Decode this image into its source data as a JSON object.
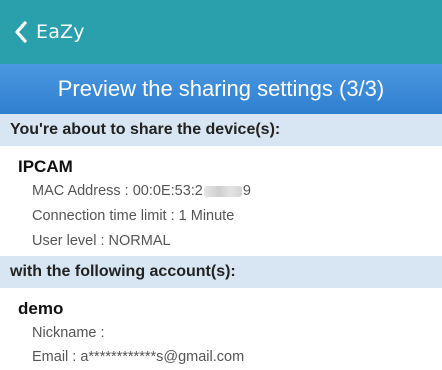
{
  "nav": {
    "back_label": "EaZy"
  },
  "header": {
    "title": "Preview the sharing settings (3/3)"
  },
  "devices_section": {
    "heading": "You're about to share the device(s):",
    "device": {
      "name": "IPCAM",
      "mac_prefix": "MAC Address : 00:0E:53:2",
      "mac_suffix": "9",
      "time_limit": "Connection time limit : 1 Minute",
      "user_level": "User level : NORMAL"
    }
  },
  "accounts_section": {
    "heading": "with the following account(s):",
    "account": {
      "name": "demo",
      "nickname": "Nickname :",
      "email": "Email : a************s@gmail.com"
    }
  },
  "colors": {
    "nav_bar": "#2aa0ad",
    "header": "#3a8ad6",
    "section_bg": "#d8e6f3"
  }
}
